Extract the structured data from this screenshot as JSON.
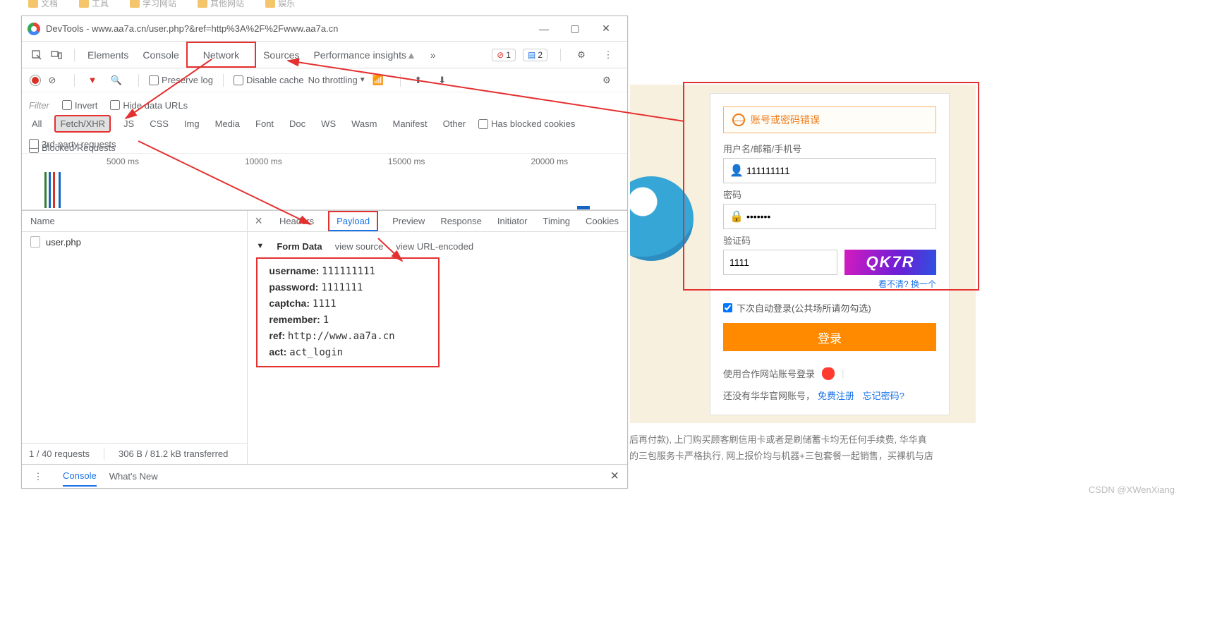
{
  "bookmarks": [
    "文档",
    "工具",
    "学习网站",
    "其他网站",
    "娱乐"
  ],
  "window": {
    "title": "DevTools - www.aa7a.cn/user.php?&ref=http%3A%2F%2Fwww.aa7a.cn",
    "min": "—",
    "max": "▢",
    "close": "✕"
  },
  "mainTabs": {
    "elements": "Elements",
    "console": "Console",
    "network": "Network",
    "sources": "Sources",
    "performance": "Performance insights",
    "more": "»"
  },
  "badges": {
    "errors": "1",
    "messages": "2"
  },
  "toolbar": {
    "preserve": "Preserve log",
    "disable": "Disable cache",
    "throttle": "No throttling"
  },
  "filter": {
    "placeholder": "Filter",
    "invert": "Invert",
    "hide": "Hide data URLs",
    "types": [
      "All",
      "Fetch/XHR",
      "JS",
      "CSS",
      "Img",
      "Media",
      "Font",
      "Doc",
      "WS",
      "Wasm",
      "Manifest",
      "Other"
    ],
    "hasBlocked": "Has blocked cookies",
    "blockedReq": "Blocked Requests",
    "thirdParty": "3rd-party requests"
  },
  "timeline": {
    "ticks": [
      "5000 ms",
      "10000 ms",
      "15000 ms",
      "20000 ms"
    ]
  },
  "requests": {
    "header": "Name",
    "items": [
      "user.php"
    ],
    "status": {
      "count": "1 / 40 requests",
      "size": "306 B / 81.2 kB transferred"
    }
  },
  "detailTabs": {
    "headers": "Headers",
    "payload": "Payload",
    "preview": "Preview",
    "response": "Response",
    "initiator": "Initiator",
    "timing": "Timing",
    "cookies": "Cookies"
  },
  "formData": {
    "title": "Form Data",
    "viewSource": "view source",
    "viewUrl": "view URL-encoded",
    "rows": [
      {
        "k": "username:",
        "v": "111111111"
      },
      {
        "k": "password:",
        "v": "1111111"
      },
      {
        "k": "captcha:",
        "v": "1111"
      },
      {
        "k": "remember:",
        "v": "1"
      },
      {
        "k": "ref:",
        "v": "http://www.aa7a.cn"
      },
      {
        "k": "act:",
        "v": "act_login"
      }
    ]
  },
  "drawer": {
    "console": "Console",
    "whatsnew": "What's New"
  },
  "login": {
    "error": "账号或密码错误",
    "userLabel": "用户名/邮箱/手机号",
    "userValue": "111111111",
    "pwdLabel": "密码",
    "pwdValue": "•••••••",
    "capLabel": "验证码",
    "capValue": "1111",
    "capText": "QK7R",
    "capLink1": "看不清?",
    "capLink2": "换一个",
    "remember": "下次自动登录(公共场所请勿勾选)",
    "submit": "登录",
    "otherLabel": "使用合作网站账号登录",
    "regPrefix": "还没有华华官网账号，",
    "regLink": "免费注册",
    "forgot": "忘记密码?"
  },
  "footer": {
    "line1": "后再付款), 上门购买顾客刷信用卡或者是刷储蓄卡均无任何手续费, 华华真",
    "line2": "的三包服务卡严格执行, 网上报价均与机器+三包套餐一起销售，买裸机与店"
  },
  "watermark": "CSDN @XWenXiang"
}
